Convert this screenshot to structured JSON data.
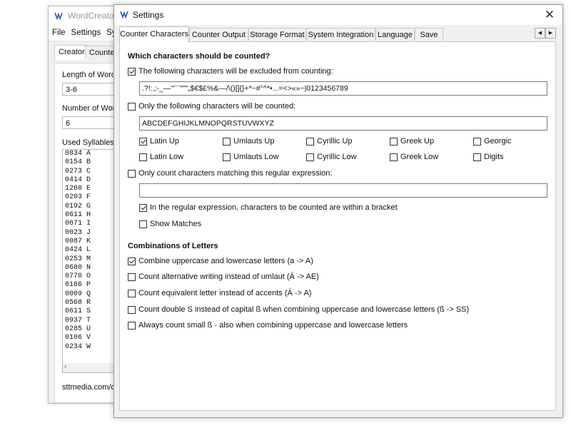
{
  "back_window": {
    "title": "WordCreator -",
    "menu": [
      "File",
      "Settings",
      "Sy"
    ],
    "tabs": [
      "Creator",
      "Counte"
    ],
    "length_label": "Length of Words",
    "length_value": "3-6",
    "number_label": "Number of Wor",
    "number_value": "6",
    "used_label": "Used Syllables",
    "syllables": [
      "0834 A",
      "0154 B",
      "0273 C",
      "0414 D",
      "1260 E",
      "0203 F",
      "0192 G",
      "0611 H",
      "0671 I",
      "0023 J",
      "0087 K",
      "0424 L",
      "0253 M",
      "0680 N",
      "0770 O",
      "0166 P",
      "0009 Q",
      "0568 R",
      "0611 S",
      "0937 T",
      "0285 U",
      "0106 V",
      "0234 W"
    ],
    "footer": "sttmedia.com/d"
  },
  "settings": {
    "title": "Settings",
    "tabs": [
      "Counter Characters",
      "Counter Output",
      "Storage Format",
      "System Integration",
      "Language",
      "Save"
    ],
    "scroll_left": "◀",
    "scroll_right": "▶",
    "section1": "Which characters should be counted?",
    "exclude": {
      "label": "The following characters will be excluded from counting:",
      "checked": true,
      "value": ".?!:,;-_—'\"`´\"\"\"„$€$£%&—/\\()[]{}+*~#°^*•...=<>«»~|0123456789"
    },
    "only": {
      "label": "Only the following characters will be counted:",
      "checked": false,
      "value": "ABCDEFGHIJKLMNOPQRSTUVWXYZ"
    },
    "charsets_row1": [
      {
        "label": "Latin Up",
        "checked": true
      },
      {
        "label": "Umlauts Up",
        "checked": false
      },
      {
        "label": "Cyrillic Up",
        "checked": false
      },
      {
        "label": "Greek Up",
        "checked": false
      },
      {
        "label": "Georgic",
        "checked": false
      }
    ],
    "charsets_row2": [
      {
        "label": "Latin Low",
        "checked": false
      },
      {
        "label": "Umlauts Low",
        "checked": false
      },
      {
        "label": "Cyrillic Low",
        "checked": false
      },
      {
        "label": "Greek Low",
        "checked": false
      },
      {
        "label": "Digits",
        "checked": false
      }
    ],
    "regex": {
      "label": "Only count characters matching this regular expression:",
      "checked": false,
      "value": ""
    },
    "bracket": {
      "label": "In the regular expression, characters to be counted are within a bracket",
      "checked": true
    },
    "show_matches": {
      "label": "Show Matches",
      "checked": false
    },
    "section2": "Combinations of Letters",
    "combinations": [
      {
        "label": "Combine uppercase and lowercase letters (a -> A)",
        "checked": true
      },
      {
        "label": "Count alternative writing instead of umlaut (Ä -> AE)",
        "checked": false
      },
      {
        "label": "Count equivalent letter instead of accents (À -> A)",
        "checked": false
      },
      {
        "label": "Count double S instead of capital ß when combining uppercase and lowercase letters (ß -> SS)",
        "checked": false
      },
      {
        "label": "Always count small ß - also when combining uppercase and lowercase letters",
        "checked": false
      }
    ]
  }
}
